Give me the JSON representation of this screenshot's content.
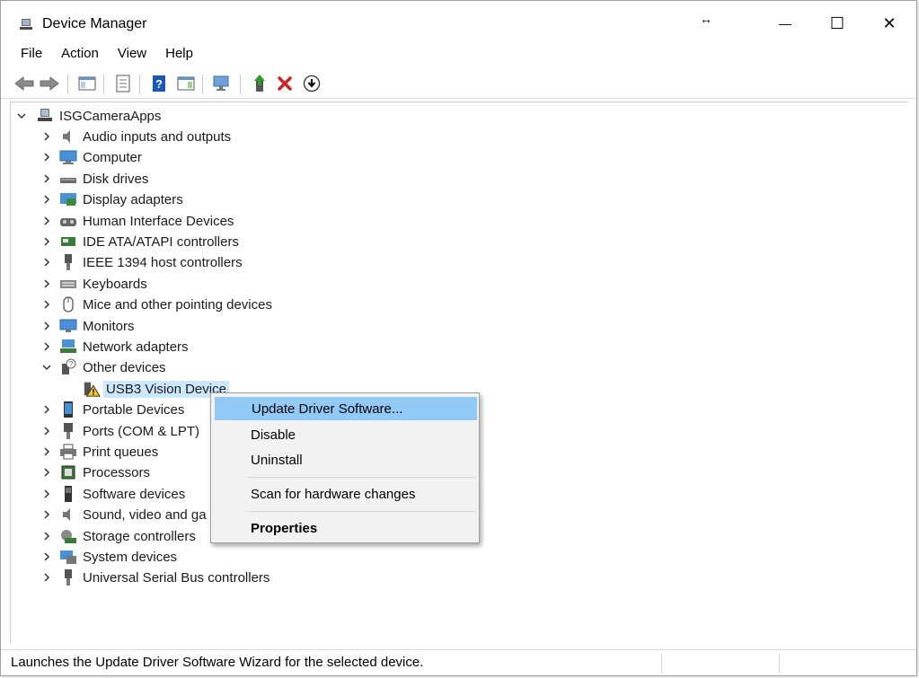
{
  "window": {
    "title": "Device Manager",
    "resize_glyph": "↔",
    "minimize_glyph": "—",
    "maximize_glyph": "☐",
    "close_glyph": "✕"
  },
  "menu": [
    "File",
    "Action",
    "View",
    "Help"
  ],
  "toolbar": {
    "items": [
      "back-arrow-icon",
      "forward-arrow-icon",
      "show-hide-console-tree-icon",
      "properties-icon",
      "help-icon",
      "show-action-pane-icon",
      "scan-hardware-icon",
      "update-driver-icon",
      "uninstall-device-icon",
      "enable-device-icon"
    ],
    "colors": {
      "help_blue": "#1e56b4",
      "uninstall_red": "#d32020",
      "update_green": "#2f9a2f"
    }
  },
  "tree": {
    "root": "ISGCameraApps",
    "categories": [
      {
        "label": "Audio inputs and outputs",
        "icon": "speaker-icon"
      },
      {
        "label": "Computer",
        "icon": "computer-icon"
      },
      {
        "label": "Disk drives",
        "icon": "disk-drive-icon"
      },
      {
        "label": "Display adapters",
        "icon": "display-adapter-icon"
      },
      {
        "label": "Human Interface Devices",
        "icon": "hid-icon"
      },
      {
        "label": "IDE ATA/ATAPI controllers",
        "icon": "ide-controller-icon"
      },
      {
        "label": "IEEE 1394 host controllers",
        "icon": "ieee1394-icon"
      },
      {
        "label": "Keyboards",
        "icon": "keyboard-icon"
      },
      {
        "label": "Mice and other pointing devices",
        "icon": "mouse-icon"
      },
      {
        "label": "Monitors",
        "icon": "monitor-icon"
      },
      {
        "label": "Network adapters",
        "icon": "network-adapter-icon"
      },
      {
        "label": "Other devices",
        "icon": "unknown-device-icon",
        "expanded": true
      },
      {
        "label": "Portable Devices",
        "icon": "portable-device-icon"
      },
      {
        "label": "Ports (COM & LPT)",
        "icon": "port-icon"
      },
      {
        "label": "Print queues",
        "icon": "printer-icon"
      },
      {
        "label": "Processors",
        "icon": "processor-icon"
      },
      {
        "label": "Software devices",
        "icon": "software-device-icon"
      },
      {
        "label": "Sound, video and ga",
        "icon": "sound-icon"
      },
      {
        "label": "Storage controllers",
        "icon": "storage-controller-icon"
      },
      {
        "label": "System devices",
        "icon": "system-device-icon"
      },
      {
        "label": "Universal Serial Bus controllers",
        "icon": "usb-icon"
      }
    ],
    "child_of_other_devices": {
      "label": "USB3 Vision Device",
      "icon": "warning-device-icon",
      "selected": true
    }
  },
  "context_menu": {
    "items": [
      "Update Driver Software...",
      "Disable",
      "Uninstall",
      "Scan for hardware changes",
      "Properties"
    ],
    "highlighted": "Update Driver Software...",
    "bold": "Properties",
    "highlight_color": "#91c9f7"
  },
  "status": {
    "text": "Launches the Update Driver Software Wizard for the selected device."
  }
}
